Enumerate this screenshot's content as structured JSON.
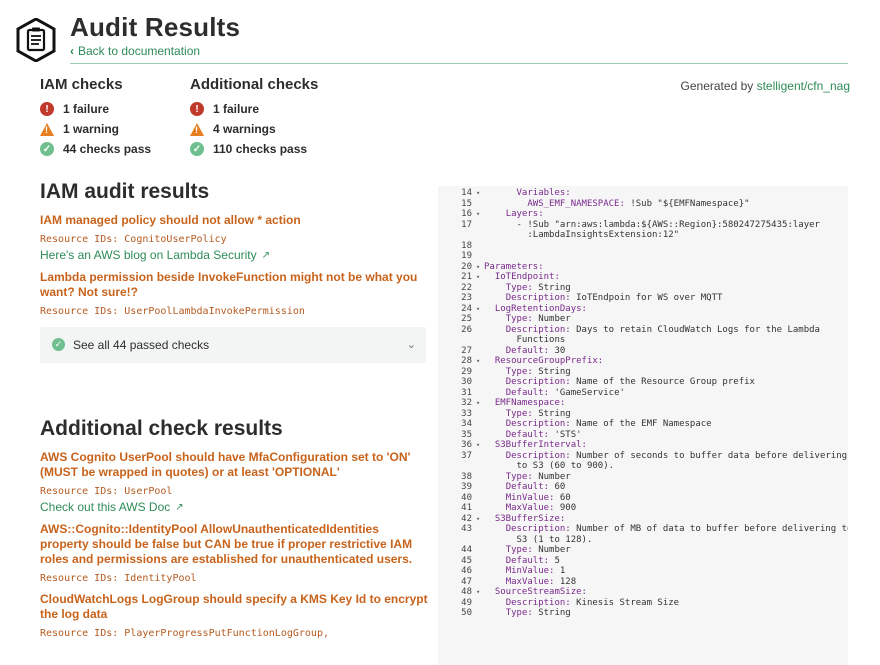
{
  "header": {
    "title": "Audit Results",
    "back_label": "Back to documentation"
  },
  "summary": {
    "iam": {
      "heading": "IAM checks",
      "failure": "1 failure",
      "warning": "1 warning",
      "pass": "44 checks pass"
    },
    "additional": {
      "heading": "Additional checks",
      "failure": "1 failure",
      "warning": "4 warnings",
      "pass": "110 checks pass"
    },
    "generated_prefix": "Generated by ",
    "generated_link": "stelligent/cfn_nag"
  },
  "iam_results": {
    "title": "IAM audit results",
    "findings": [
      {
        "title": "IAM managed policy should not allow * action",
        "resources": "Resource IDs: CognitoUserPolicy",
        "link": "Here's an AWS blog on Lambda Security"
      },
      {
        "title": "Lambda permission beside InvokeFunction might not be what you want? Not sure!?",
        "resources": "Resource IDs: UserPoolLambdaInvokePermission"
      }
    ],
    "passed_label": "See all 44 passed checks"
  },
  "additional_results": {
    "title": "Additional check results",
    "findings": [
      {
        "title": "AWS Cognito UserPool should have MfaConfiguration set to 'ON' (MUST be wrapped in quotes) or at least 'OPTIONAL'",
        "resources": "Resource IDs: UserPool",
        "link": "Check out this AWS Doc"
      },
      {
        "title": "AWS::Cognito::IdentityPool AllowUnauthenticatedIdentities property should be false but CAN be true if proper restrictive IAM roles and permissions are established for unauthenticated users.",
        "resources": "Resource IDs: IdentityPool"
      },
      {
        "title": "CloudWatchLogs LogGroup should specify a KMS Key Id to encrypt the log data",
        "resources": "Resource IDs: PlayerProgressPutFunctionLogGroup,"
      }
    ]
  },
  "code_lines": [
    {
      "n": "14",
      "f": true,
      "i": "      ",
      "k": "Variables:",
      "v": ""
    },
    {
      "n": "15",
      "f": false,
      "i": "        ",
      "k": "AWS_EMF_NAMESPACE:",
      "v": " !Sub \"${EMFNamespace}\""
    },
    {
      "n": "16",
      "f": true,
      "i": "    ",
      "k": "Layers:",
      "v": ""
    },
    {
      "n": "17",
      "f": false,
      "i": "      ",
      "k": "",
      "v": "- !Sub \"arn:aws:lambda:${AWS::Region}:580247275435:layer"
    },
    {
      "n": "",
      "f": false,
      "i": "        ",
      "k": "",
      "v": ":LambdaInsightsExtension:12\""
    },
    {
      "n": "18",
      "f": false,
      "i": "",
      "k": "",
      "v": ""
    },
    {
      "n": "19",
      "f": false,
      "i": "",
      "k": "",
      "v": ""
    },
    {
      "n": "20",
      "f": true,
      "i": "",
      "k": "Parameters:",
      "v": ""
    },
    {
      "n": "21",
      "f": true,
      "i": "  ",
      "k": "IoTEndpoint:",
      "v": ""
    },
    {
      "n": "22",
      "f": false,
      "i": "    ",
      "k": "Type:",
      "v": " String"
    },
    {
      "n": "23",
      "f": false,
      "i": "    ",
      "k": "Description:",
      "v": " IoTEndpoin for WS over MQTT"
    },
    {
      "n": "24",
      "f": true,
      "i": "  ",
      "k": "LogRetentionDays:",
      "v": ""
    },
    {
      "n": "25",
      "f": false,
      "i": "    ",
      "k": "Type:",
      "v": " Number"
    },
    {
      "n": "26",
      "f": false,
      "i": "    ",
      "k": "Description:",
      "v": " Days to retain CloudWatch Logs for the Lambda"
    },
    {
      "n": "",
      "f": false,
      "i": "      ",
      "k": "",
      "v": "Functions"
    },
    {
      "n": "27",
      "f": false,
      "i": "    ",
      "k": "Default:",
      "v": " 30"
    },
    {
      "n": "28",
      "f": true,
      "i": "  ",
      "k": "ResourceGroupPrefix:",
      "v": ""
    },
    {
      "n": "29",
      "f": false,
      "i": "    ",
      "k": "Type:",
      "v": " String"
    },
    {
      "n": "30",
      "f": false,
      "i": "    ",
      "k": "Description:",
      "v": " Name of the Resource Group prefix"
    },
    {
      "n": "31",
      "f": false,
      "i": "    ",
      "k": "Default:",
      "v": " 'GameService'"
    },
    {
      "n": "32",
      "f": true,
      "i": "  ",
      "k": "EMFNamespace:",
      "v": ""
    },
    {
      "n": "33",
      "f": false,
      "i": "    ",
      "k": "Type:",
      "v": " String"
    },
    {
      "n": "34",
      "f": false,
      "i": "    ",
      "k": "Description:",
      "v": " Name of the EMF Namespace"
    },
    {
      "n": "35",
      "f": false,
      "i": "    ",
      "k": "Default:",
      "v": " 'STS'"
    },
    {
      "n": "36",
      "f": true,
      "i": "  ",
      "k": "S3BufferInterval:",
      "v": ""
    },
    {
      "n": "37",
      "f": false,
      "i": "    ",
      "k": "Description:",
      "v": " Number of seconds to buffer data before delivering"
    },
    {
      "n": "",
      "f": false,
      "i": "      ",
      "k": "",
      "v": "to S3 (60 to 900)."
    },
    {
      "n": "38",
      "f": false,
      "i": "    ",
      "k": "Type:",
      "v": " Number"
    },
    {
      "n": "39",
      "f": false,
      "i": "    ",
      "k": "Default:",
      "v": " 60"
    },
    {
      "n": "40",
      "f": false,
      "i": "    ",
      "k": "MinValue:",
      "v": " 60"
    },
    {
      "n": "41",
      "f": false,
      "i": "    ",
      "k": "MaxValue:",
      "v": " 900"
    },
    {
      "n": "42",
      "f": true,
      "i": "  ",
      "k": "S3BufferSize:",
      "v": ""
    },
    {
      "n": "43",
      "f": false,
      "i": "    ",
      "k": "Description:",
      "v": " Number of MB of data to buffer before delivering to"
    },
    {
      "n": "",
      "f": false,
      "i": "      ",
      "k": "",
      "v": "S3 (1 to 128)."
    },
    {
      "n": "44",
      "f": false,
      "i": "    ",
      "k": "Type:",
      "v": " Number"
    },
    {
      "n": "45",
      "f": false,
      "i": "    ",
      "k": "Default:",
      "v": " 5"
    },
    {
      "n": "46",
      "f": false,
      "i": "    ",
      "k": "MinValue:",
      "v": " 1"
    },
    {
      "n": "47",
      "f": false,
      "i": "    ",
      "k": "MaxValue:",
      "v": " 128"
    },
    {
      "n": "48",
      "f": true,
      "i": "  ",
      "k": "SourceStreamSize:",
      "v": ""
    },
    {
      "n": "49",
      "f": false,
      "i": "    ",
      "k": "Description:",
      "v": " Kinesis Stream Size"
    },
    {
      "n": "50",
      "f": false,
      "i": "    ",
      "k": "Type:",
      "v": " String"
    }
  ],
  "colors": {
    "accent_green": "#2e8b57",
    "failure_red": "#c0392b",
    "warning_orange": "#e67e22",
    "finding_title": "#c8631c",
    "pass_green": "#6fbf8f"
  }
}
